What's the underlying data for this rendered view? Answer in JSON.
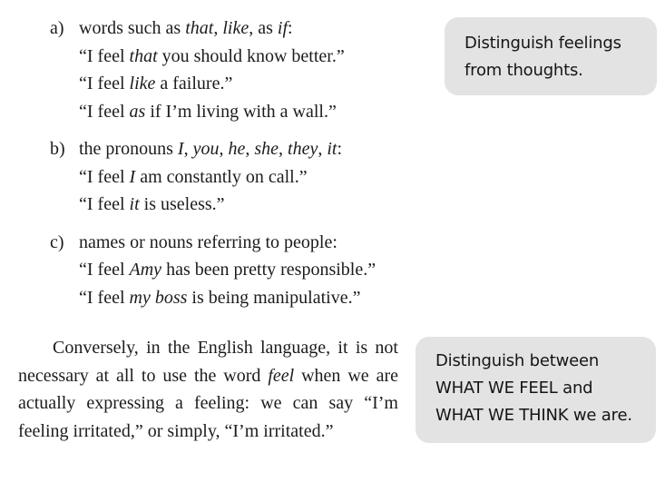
{
  "list": [
    {
      "marker": "a)",
      "lead": "words such as ",
      "w1": "that",
      "s1": ", ",
      "w2": "like",
      "s2": ", as ",
      "w3": "if",
      "s3": ":",
      "ex": [
        {
          "pre": "“I feel ",
          "em": "that",
          "post": " you should know better.”"
        },
        {
          "pre": "“I feel ",
          "em": "like",
          "post": " a failure.”"
        },
        {
          "pre": "“I feel ",
          "em": "as",
          "post": " if I’m living with a wall.”"
        }
      ]
    },
    {
      "marker": "b)",
      "lead": "the pronouns ",
      "p1": "I",
      "p2": "you",
      "p3": "he",
      "p4": "she",
      "p5": "they",
      "p6": "it",
      "comma": ", ",
      "colon": ":",
      "ex": [
        {
          "pre": "“I feel ",
          "em": "I",
          "post": " am constantly on call.”"
        },
        {
          "pre": "“I feel ",
          "em": "it",
          "post": " is useless.”"
        }
      ]
    },
    {
      "marker": "c)",
      "lead": "names or nouns referring to people:",
      "ex": [
        {
          "pre": "“I feel ",
          "em": "Amy",
          "post": " has been pretty responsible.”"
        },
        {
          "pre": "“I feel ",
          "em": "my boss",
          "post": " is being manipulative.”"
        }
      ]
    }
  ],
  "paragraph": {
    "pre": "Conversely, in the English language, it is not necessary at all to use the word ",
    "em": "feel",
    "post": " when we are actually expressing a feeling: we can say “I’m feeling irritated,” or simply, “I’m irritated.”"
  },
  "notes": [
    {
      "lines": [
        "Distinguish feelings",
        "from thoughts."
      ]
    },
    {
      "lines": [
        "Distinguish between",
        "WHAT WE FEEL and",
        "WHAT WE THINK we are."
      ]
    }
  ]
}
